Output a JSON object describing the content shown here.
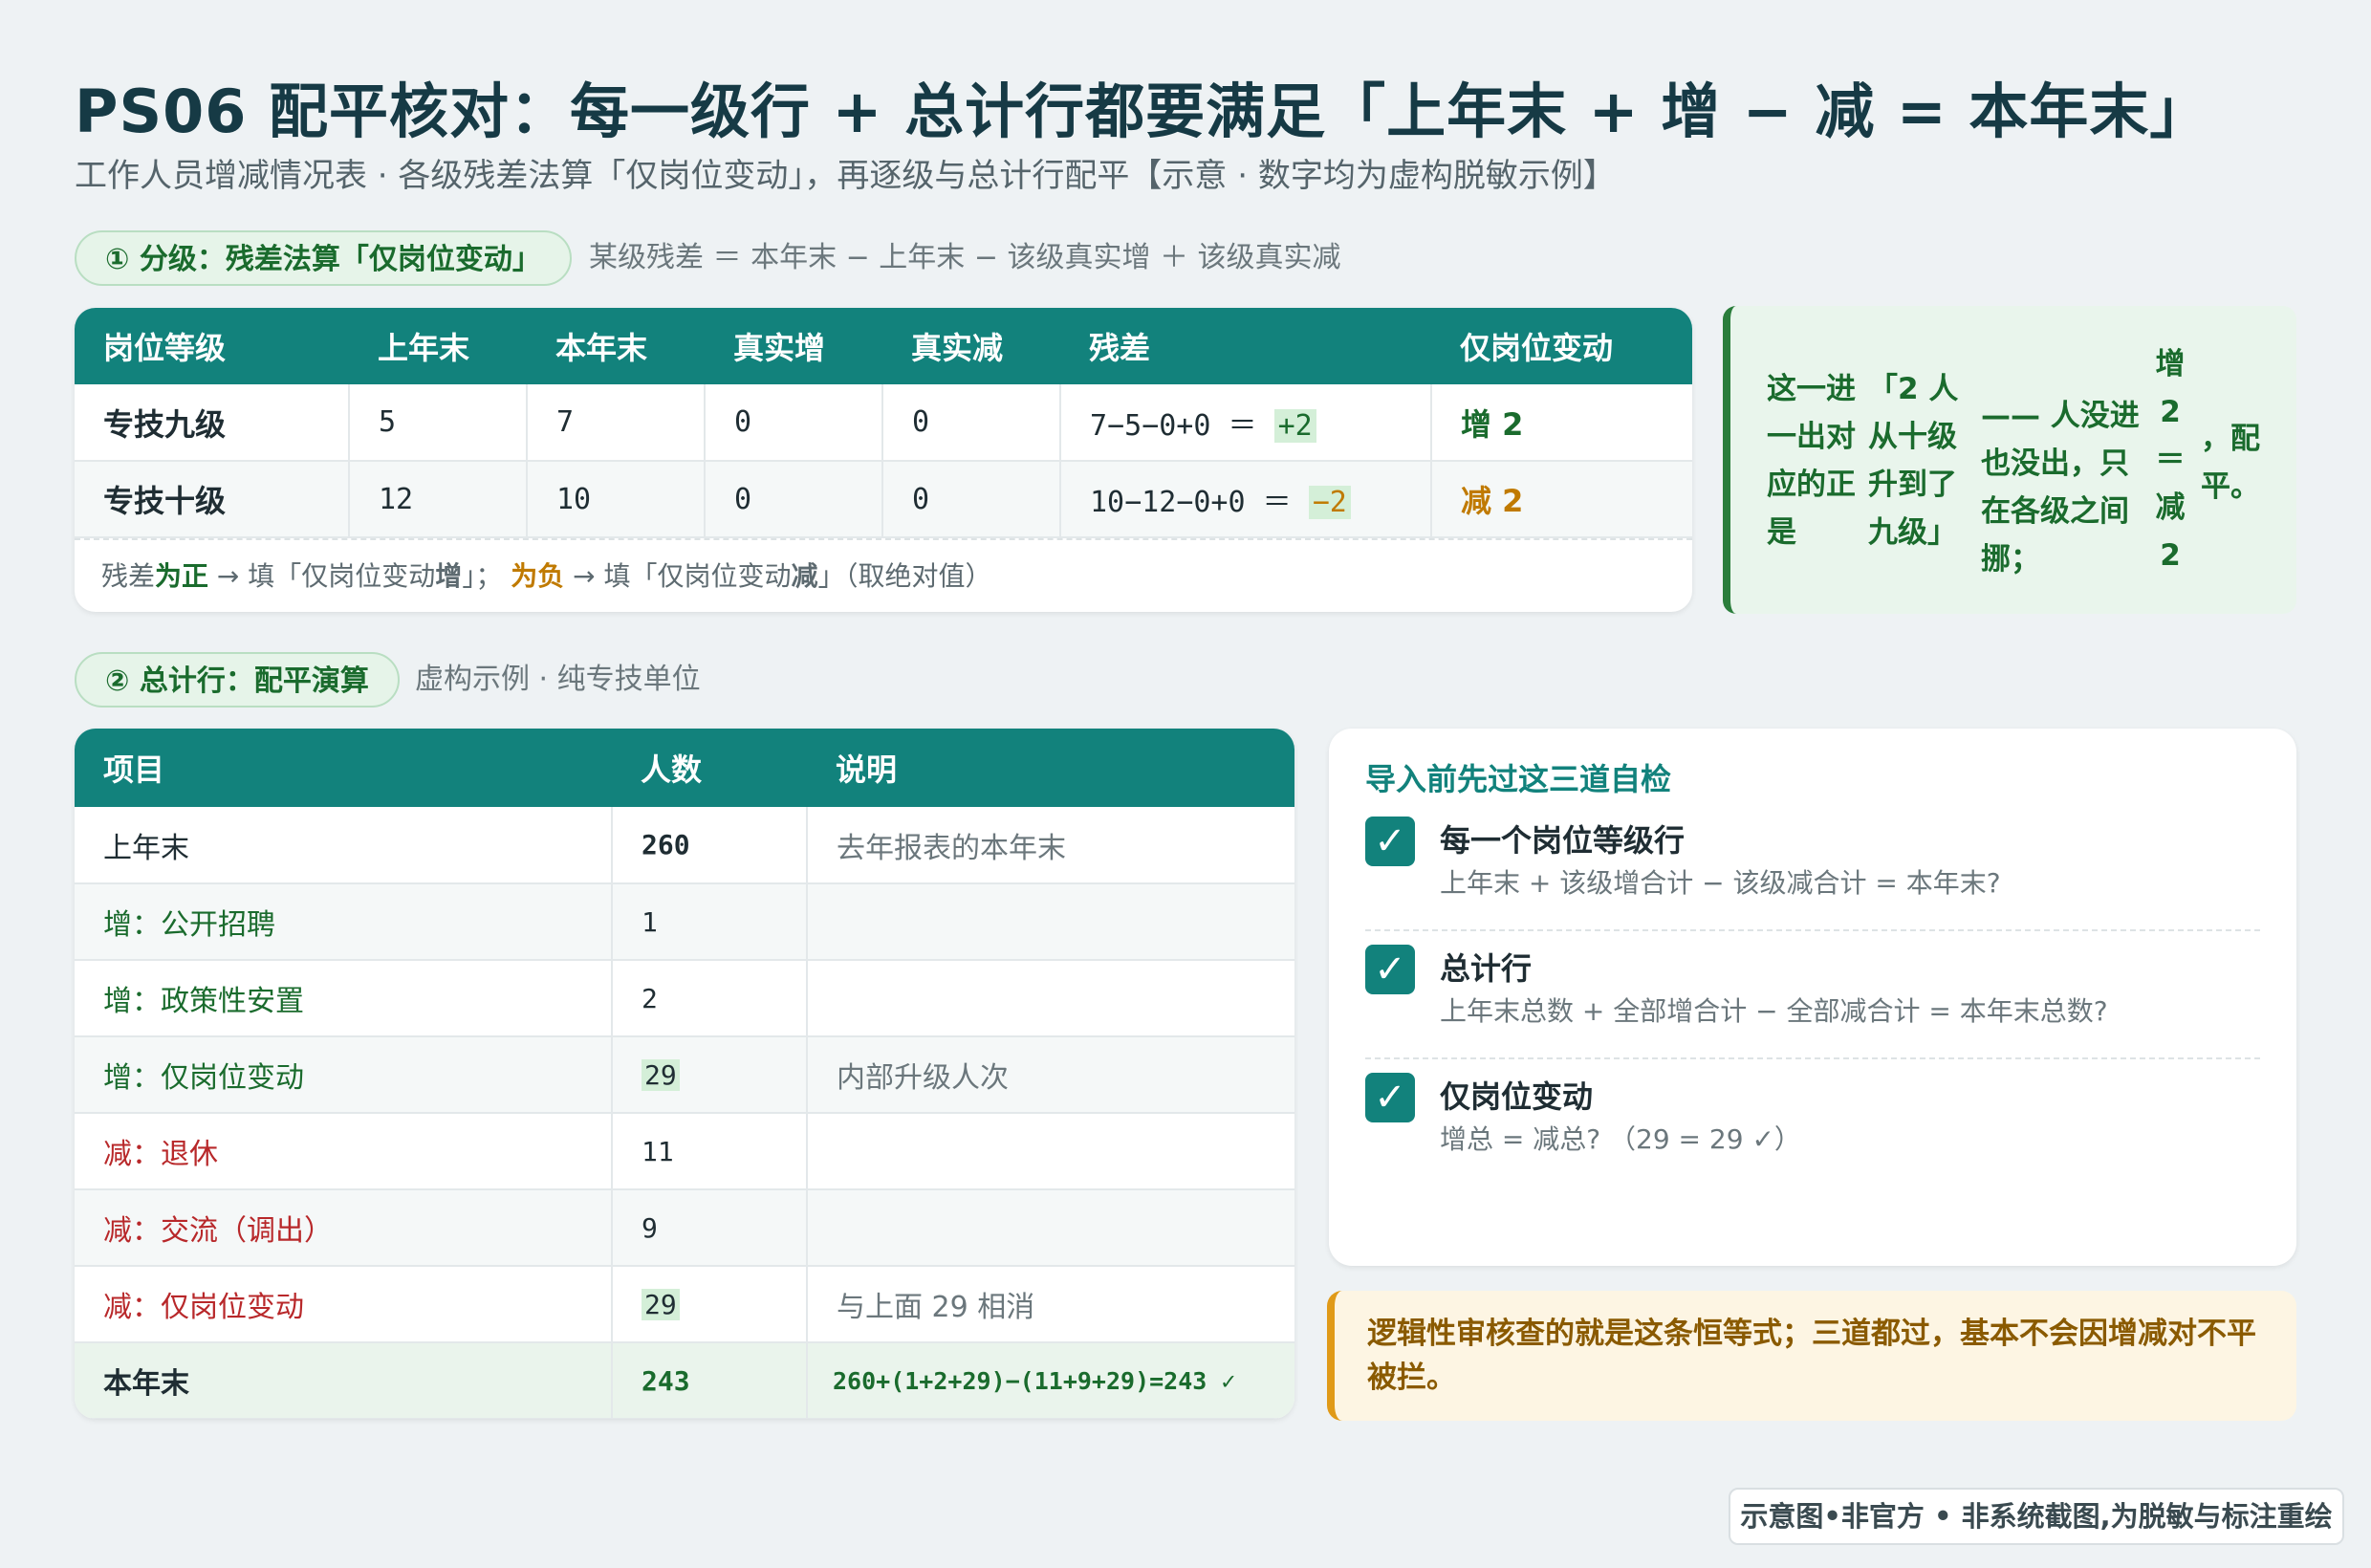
{
  "header": {
    "title": "PS06 配平核对：每一级行 + 总计行都要满足「上年末 + 增 − 减 = 本年末」",
    "subtitle": "工作人员增减情况表 · 各级残差法算「仅岗位变动」，再逐级与总计行配平【示意 · 数字均为虚构脱敏示例】"
  },
  "section1": {
    "pill": "① 分级：残差法算「仅岗位变动」",
    "formula": "某级残差 ＝ 本年末 − 上年末 − 该级真实增 ＋ 该级真实减"
  },
  "table1": {
    "headers": [
      "岗位等级",
      "上年末",
      "本年末",
      "真实增",
      "真实减",
      "残差",
      "仅岗位变动"
    ],
    "rows": [
      {
        "level": "专技九级",
        "prev": "5",
        "curr": "7",
        "inc": "0",
        "dec": "0",
        "calc": "7−5−0+0 ＝ ",
        "resid": "+2",
        "change": "增 2"
      },
      {
        "level": "专技十级",
        "prev": "12",
        "curr": "10",
        "inc": "0",
        "dec": "0",
        "calc": "10−12−0+0 ＝ ",
        "resid": "−2",
        "change": "减 2"
      }
    ],
    "note": {
      "p1": "残差",
      "pos": "为正",
      "p2": " → 填「仅岗位变动",
      "zeng": "增",
      "p3": "」； ",
      "neg": "为负",
      "p4": " → 填「仅岗位变动",
      "jian": "减",
      "p5": "」（取绝对值）"
    }
  },
  "greenbox": {
    "c1": "这一进一出对应的正是",
    "c2": "「2 人从十级升到了九级」",
    "c3": "—— 人没进也没出，只在各级之间挪；",
    "c4": "增 2 ＝ 减 2",
    "c5": "，配平。"
  },
  "section2": {
    "pill": "② 总计行：配平演算",
    "note": "虚构示例 · 纯专技单位"
  },
  "table2": {
    "headers": [
      "项目",
      "人数",
      "说明"
    ],
    "rows": [
      {
        "item": "上年末",
        "count": "260",
        "desc": "去年报表的本年末"
      },
      {
        "item": "增：公开招聘",
        "count": "1",
        "desc": ""
      },
      {
        "item": "增：政策性安置",
        "count": "2",
        "desc": ""
      },
      {
        "item": "增：仅岗位变动",
        "count": "29",
        "desc": "内部升级人次"
      },
      {
        "item": "减：退休",
        "count": "11",
        "desc": ""
      },
      {
        "item": "减：交流（调出）",
        "count": "9",
        "desc": ""
      },
      {
        "item": "减：仅岗位变动",
        "count": "29",
        "desc": "与上面 29 相消"
      },
      {
        "item": "本年末",
        "count": "243",
        "desc": "260+(1+2+29)−(11+9+29)=243 ✓"
      }
    ]
  },
  "checklist": {
    "title": "导入前先过这三道自检",
    "items": [
      {
        "head": "每一个岗位等级行",
        "sub": "上年末 + 该级增合计 − 该级减合计 = 本年末?"
      },
      {
        "head": "总计行",
        "sub": "上年末总数 + 全部增合计 − 全部减合计 = 本年末总数?"
      },
      {
        "head": "仅岗位变动",
        "sub": "增总 = 减总? （29 = 29 ✓）"
      }
    ]
  },
  "callout": "逻辑性审核查的就是这条恒等式；三道都过，基本不会因增减对不平被拦。",
  "footer": "示意图•非官方 • 非系统截图,为脱敏与标注重绘",
  "colors": {
    "teal": "#12827c",
    "green": "#1a6b2d",
    "orange": "#c07a00",
    "red": "#b8282a",
    "amber": "#e09a18"
  }
}
